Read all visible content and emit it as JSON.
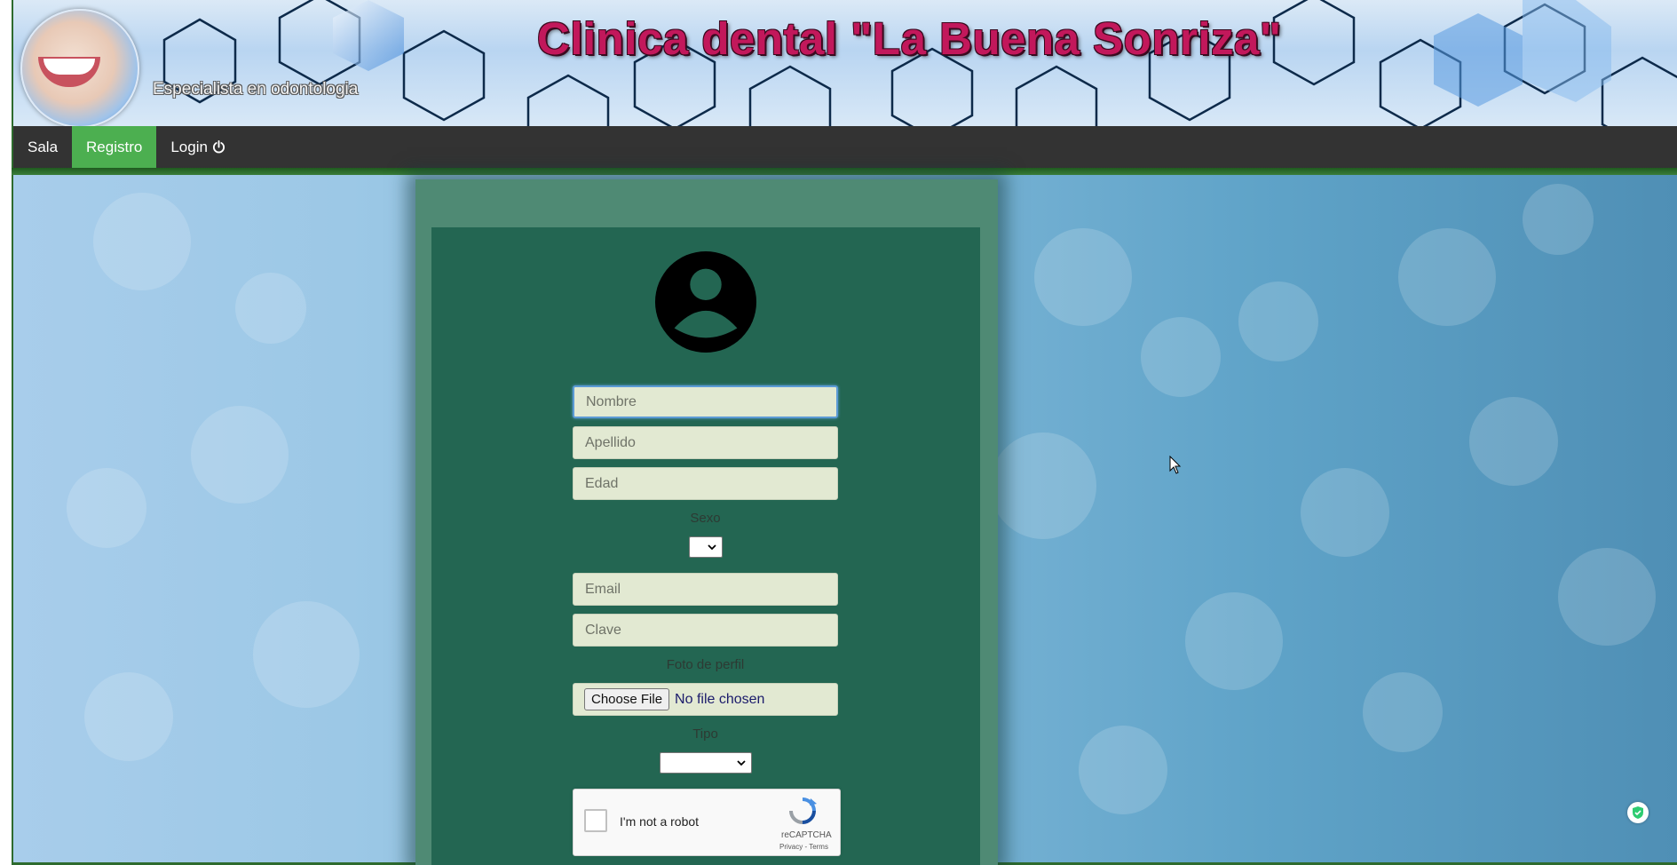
{
  "header": {
    "title": "Clinica dental \"La Buena Sonriza\"",
    "subtitle": "Especialista en odontologia"
  },
  "nav": {
    "items": [
      {
        "label": "Sala",
        "active": false
      },
      {
        "label": "Registro",
        "active": true
      },
      {
        "label": "Login",
        "active": false,
        "icon": "power-icon"
      }
    ]
  },
  "form": {
    "nombre_placeholder": "Nombre",
    "apellido_placeholder": "Apellido",
    "edad_placeholder": "Edad",
    "sexo_label": "Sexo",
    "sexo_value": "",
    "email_placeholder": "Email",
    "clave_placeholder": "Clave",
    "foto_label": "Foto de perfil",
    "file_button": "Choose File",
    "file_status": "No file chosen",
    "tipo_label": "Tipo",
    "tipo_value": ""
  },
  "captcha": {
    "label": "I'm not a robot",
    "brand": "reCAPTCHA",
    "links": "Privacy - Terms"
  },
  "colors": {
    "title": "#c2185b",
    "nav_bg": "#333333",
    "nav_active": "#4caf50",
    "panel": "#236652",
    "field_bg": "#e2e9d2"
  }
}
